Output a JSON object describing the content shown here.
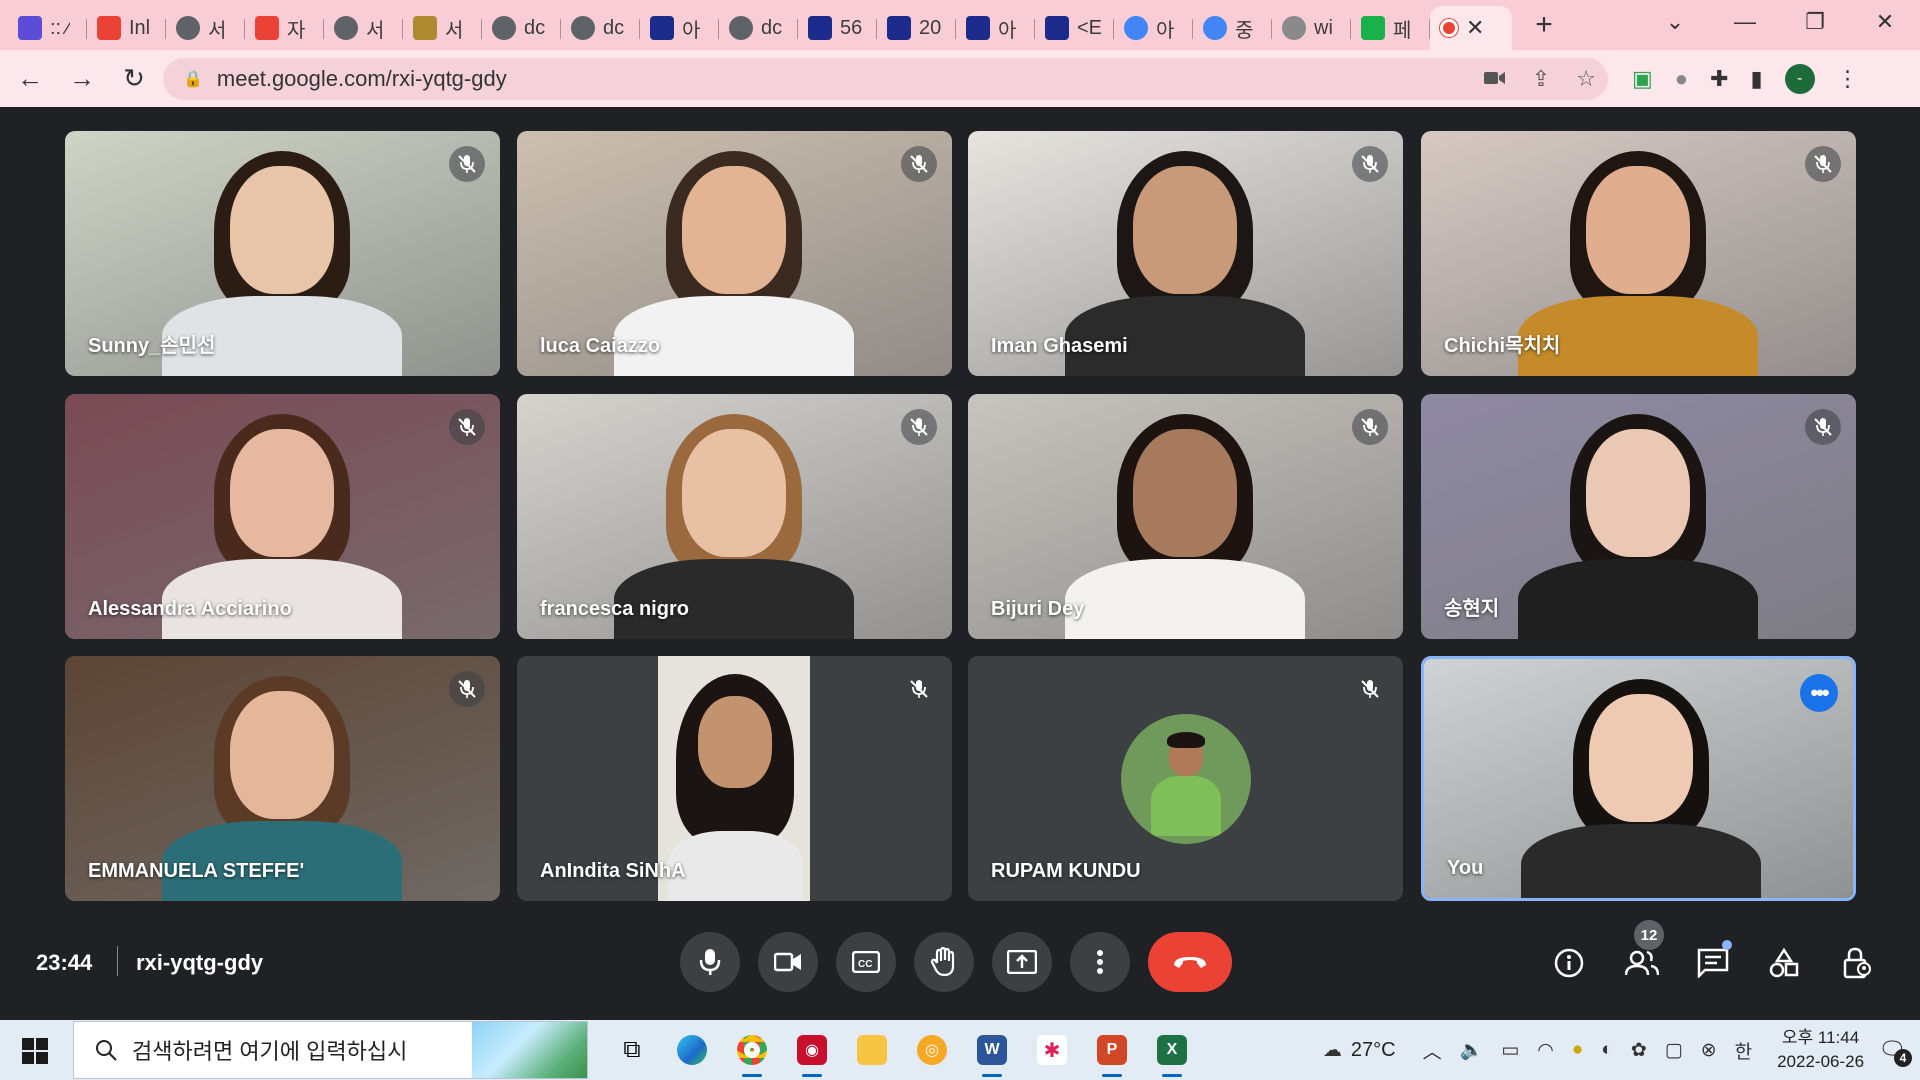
{
  "browser": {
    "tabs": [
      {
        "title": ":: ⁄",
        "icon": "collab-icon",
        "color": "#5b4dd6"
      },
      {
        "title": "Inl",
        "icon": "gmail-icon",
        "color": "#ea4335"
      },
      {
        "title": "서",
        "icon": "globe-icon",
        "color": "#5f6368"
      },
      {
        "title": "자",
        "icon": "gmail-icon",
        "color": "#ea4335"
      },
      {
        "title": "서",
        "icon": "globe-icon",
        "color": "#5f6368"
      },
      {
        "title": "서",
        "icon": "notebook-icon",
        "color": "#b08a2e"
      },
      {
        "title": "dc",
        "icon": "globe-icon",
        "color": "#5f6368"
      },
      {
        "title": "dc",
        "icon": "globe-icon",
        "color": "#5f6368"
      },
      {
        "title": "아",
        "icon": "puzzle-app-icon",
        "color": "#1c2b8c"
      },
      {
        "title": "dc",
        "icon": "globe-icon",
        "color": "#5f6368"
      },
      {
        "title": "56",
        "icon": "puzzle-app-icon",
        "color": "#1c2b8c"
      },
      {
        "title": "20",
        "icon": "puzzle-app-icon",
        "color": "#1c2b8c"
      },
      {
        "title": "아",
        "icon": "puzzle-app-icon",
        "color": "#1c2b8c"
      },
      {
        "title": "<E",
        "icon": "puzzle-app-icon",
        "color": "#1c2b8c"
      },
      {
        "title": "아",
        "icon": "google-icon",
        "color": "#4285f4"
      },
      {
        "title": "중",
        "icon": "google-icon",
        "color": "#4285f4"
      },
      {
        "title": "wi",
        "icon": "globe-icon",
        "color": "#8a8a8a"
      },
      {
        "title": "페",
        "icon": "blog-icon",
        "color": "#19b24a"
      }
    ],
    "active_tab": {
      "icon": "recording-icon",
      "color": "#ea4335"
    },
    "url": "meet.google.com/rxi-yqtg-gdy",
    "profile_initial": "-"
  },
  "meet": {
    "participants": [
      {
        "name": "Sunny_손민선",
        "muted": true,
        "bg": "#cfd4c6",
        "skin": "#e8c4a8",
        "hair": "#2b1d14",
        "shirt": "#dfe3e6"
      },
      {
        "name": "luca Caiazzo",
        "muted": true,
        "bg": "#cdbfb0",
        "skin": "#e3b493",
        "hair": "#3a2a20",
        "shirt": "#f2f2f2"
      },
      {
        "name": "Iman Ghasemi",
        "muted": true,
        "bg": "#e7e4e0",
        "skin": "#c99a7a",
        "hair": "#1c1714",
        "shirt": "#2b2b2b"
      },
      {
        "name": "Chichi목치치",
        "muted": true,
        "bg": "#d7c9c3",
        "skin": "#e0ae8e",
        "hair": "#1f1612",
        "shirt": "#c58b2b"
      },
      {
        "name": "Alessandra Acciarino",
        "muted": true,
        "bg": "#7a4a55",
        "skin": "#e6b8a0",
        "hair": "#4a2a1c",
        "shirt": "#e9e4e2"
      },
      {
        "name": "francesca nigro",
        "muted": true,
        "bg": "#d6d3cf",
        "skin": "#e8c0a3",
        "hair": "#9a6a3e",
        "shirt": "#2a2a2a"
      },
      {
        "name": "Bijuri Dey",
        "muted": true,
        "bg": "#c8c4bf",
        "skin": "#a87a5d",
        "hair": "#1d1411",
        "shirt": "#f4f2ee"
      },
      {
        "name": "송현지",
        "muted": true,
        "bg": "#8f8aa3",
        "skin": "#ebc8b4",
        "hair": "#1a1512",
        "shirt": "#1f1f1f"
      },
      {
        "name": "EMMANUELA STEFFE'",
        "muted": true,
        "bg": "#5c4535",
        "skin": "#e4b79a",
        "hair": "#5b3a26",
        "shirt": "#2c6e77"
      },
      {
        "name": "AnIndita SiNhA",
        "muted": true,
        "bg": "#3c4043",
        "skin": "#c3926f",
        "hair": "#1b1412",
        "shirt": "#e9e9e9"
      },
      {
        "name": "RUPAM KUNDU",
        "muted": true,
        "bg": "#3c4043",
        "skin": "#b07a58",
        "hair": "#1b1412",
        "shirt": "#7fbf5a"
      },
      {
        "name": "You",
        "muted": false,
        "bg": "#cfd3d5",
        "skin": "#efcab3",
        "hair": "#15110f",
        "shirt": "#2a2a2a"
      }
    ],
    "time": "23:44",
    "meeting_code": "rxi-yqtg-gdy",
    "participant_count": "12"
  },
  "taskbar": {
    "search_placeholder": "검색하려면 여기에 입력하십시",
    "weather": "27°C",
    "ime": "한",
    "time": "오후 11:44",
    "date": "2022-06-26",
    "notifications": "4"
  }
}
